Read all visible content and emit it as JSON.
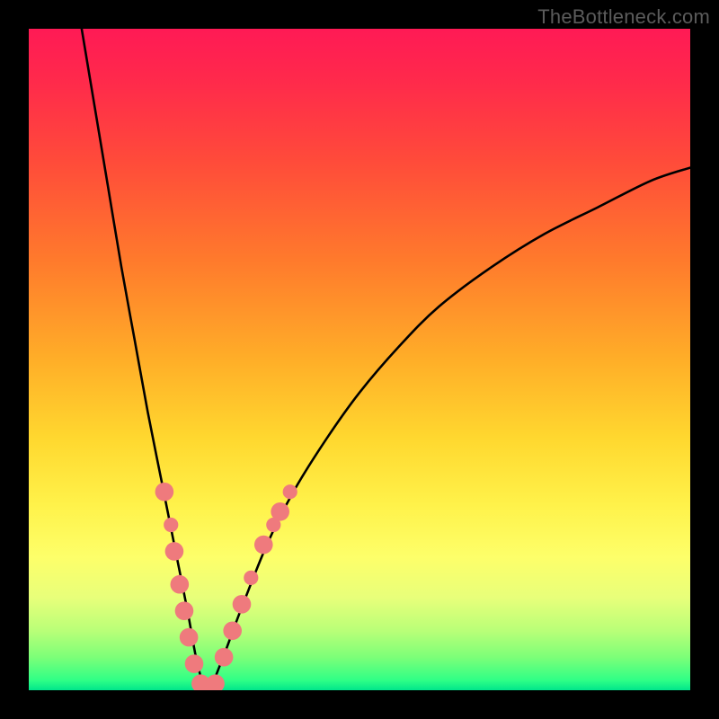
{
  "watermark": {
    "text": "TheBottleneck.com"
  },
  "gradient": {
    "stops": [
      {
        "offset": 0.0,
        "color": "#ff1a55"
      },
      {
        "offset": 0.08,
        "color": "#ff2a4b"
      },
      {
        "offset": 0.2,
        "color": "#ff4b3a"
      },
      {
        "offset": 0.35,
        "color": "#ff7a2c"
      },
      {
        "offset": 0.5,
        "color": "#ffae28"
      },
      {
        "offset": 0.62,
        "color": "#ffd82f"
      },
      {
        "offset": 0.72,
        "color": "#fff24a"
      },
      {
        "offset": 0.8,
        "color": "#fdff6a"
      },
      {
        "offset": 0.86,
        "color": "#e8ff7a"
      },
      {
        "offset": 0.91,
        "color": "#b9ff78"
      },
      {
        "offset": 0.95,
        "color": "#7dff78"
      },
      {
        "offset": 0.985,
        "color": "#2fff86"
      },
      {
        "offset": 1.0,
        "color": "#00e58b"
      }
    ]
  },
  "chart_data": {
    "type": "line",
    "title": "",
    "xlabel": "",
    "ylabel": "",
    "xlim": [
      0,
      100
    ],
    "ylim": [
      0,
      100
    ],
    "grid": false,
    "series": [
      {
        "name": "bottleneck-curve",
        "x": [
          8,
          10,
          12,
          14,
          16,
          18,
          20,
          22,
          24,
          25.5,
          27,
          29,
          32,
          36,
          40,
          45,
          50,
          56,
          62,
          70,
          78,
          86,
          94,
          100
        ],
        "y": [
          100,
          88,
          76,
          64,
          53,
          42,
          32,
          22,
          12,
          4,
          0,
          4,
          12,
          22,
          30,
          38,
          45,
          52,
          58,
          64,
          69,
          73,
          77,
          79
        ]
      }
    ],
    "scatter": {
      "name": "highlight-points",
      "color": "#ef7a7d",
      "points": [
        {
          "x": 20.5,
          "y": 30,
          "r": 1.4
        },
        {
          "x": 21.5,
          "y": 25,
          "r": 1.1
        },
        {
          "x": 22.0,
          "y": 21,
          "r": 1.4
        },
        {
          "x": 22.8,
          "y": 16,
          "r": 1.4
        },
        {
          "x": 23.5,
          "y": 12,
          "r": 1.4
        },
        {
          "x": 24.2,
          "y": 8,
          "r": 1.4
        },
        {
          "x": 25.0,
          "y": 4,
          "r": 1.4
        },
        {
          "x": 26.0,
          "y": 1,
          "r": 1.4
        },
        {
          "x": 27.0,
          "y": 0,
          "r": 1.4
        },
        {
          "x": 28.2,
          "y": 1,
          "r": 1.4
        },
        {
          "x": 29.5,
          "y": 5,
          "r": 1.4
        },
        {
          "x": 30.8,
          "y": 9,
          "r": 1.4
        },
        {
          "x": 32.2,
          "y": 13,
          "r": 1.4
        },
        {
          "x": 33.6,
          "y": 17,
          "r": 1.1
        },
        {
          "x": 35.5,
          "y": 22,
          "r": 1.4
        },
        {
          "x": 37.0,
          "y": 25,
          "r": 1.1
        },
        {
          "x": 38.0,
          "y": 27,
          "r": 1.4
        },
        {
          "x": 39.5,
          "y": 30,
          "r": 1.1
        }
      ]
    }
  }
}
